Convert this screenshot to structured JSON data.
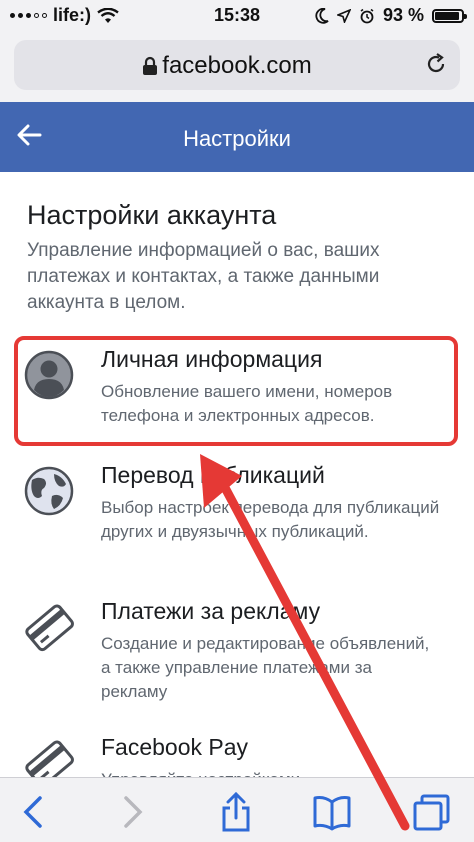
{
  "status_bar": {
    "carrier": "life:)",
    "time": "15:38",
    "battery_percent_label": "93 %",
    "battery_level": 0.93
  },
  "browser": {
    "url": "facebook.com"
  },
  "nav": {
    "title": "Настройки"
  },
  "settings": {
    "section_title": "Настройки аккаунта",
    "section_desc": "Управление информацией о вас, ваших платежах и контактах, а также данными аккаунта в целом.",
    "items": [
      {
        "title": "Личная информация",
        "desc": "Обновление вашего имени, номеров телефона и электронных адресов.",
        "icon": "user-avatar-icon"
      },
      {
        "title": "Перевод публикаций",
        "desc": "Выбор настроек перевода для публикаций других и двуязычных публикаций.",
        "icon": "globe-icon"
      },
      {
        "title": "Платежи за рекламу",
        "desc": "Создание и редактирование объявлений, а также управление платежами за рекламу",
        "icon": "credit-card-icon"
      },
      {
        "title": "Facebook Pay",
        "desc": "Управляйте настройками",
        "icon": "credit-card-icon"
      }
    ]
  },
  "colors": {
    "facebook_blue": "#4267b2",
    "highlight_red": "#e53935"
  }
}
